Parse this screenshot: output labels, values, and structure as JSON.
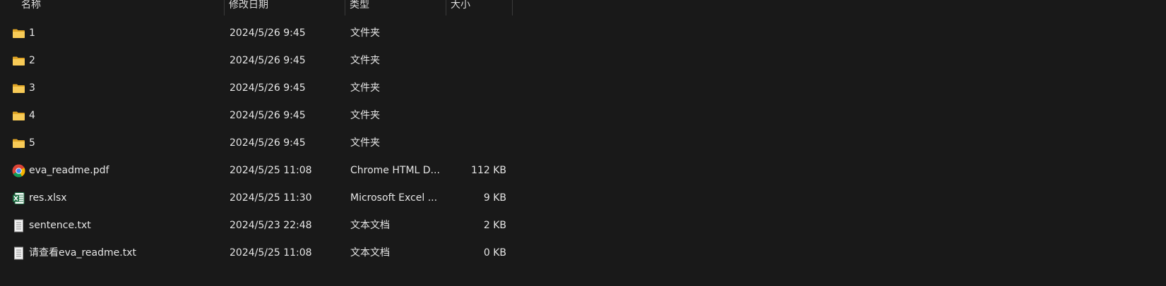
{
  "columns": {
    "name": "名称",
    "date": "修改日期",
    "type": "类型",
    "size": "大小"
  },
  "files": [
    {
      "name": "1",
      "date": "2024/5/26 9:45",
      "type": "文件夹",
      "size": "",
      "icon": "folder-icon"
    },
    {
      "name": "2",
      "date": "2024/5/26 9:45",
      "type": "文件夹",
      "size": "",
      "icon": "folder-icon"
    },
    {
      "name": "3",
      "date": "2024/5/26 9:45",
      "type": "文件夹",
      "size": "",
      "icon": "folder-icon"
    },
    {
      "name": "4",
      "date": "2024/5/26 9:45",
      "type": "文件夹",
      "size": "",
      "icon": "folder-icon"
    },
    {
      "name": "5",
      "date": "2024/5/26 9:45",
      "type": "文件夹",
      "size": "",
      "icon": "folder-icon"
    },
    {
      "name": "eva_readme.pdf",
      "date": "2024/5/25 11:08",
      "type": "Chrome HTML D...",
      "size": "112 KB",
      "icon": "chrome-icon"
    },
    {
      "name": "res.xlsx",
      "date": "2024/5/25 11:30",
      "type": "Microsoft Excel ...",
      "size": "9 KB",
      "icon": "excel-icon"
    },
    {
      "name": "sentence.txt",
      "date": "2024/5/23 22:48",
      "type": "文本文档",
      "size": "2 KB",
      "icon": "text-file-icon"
    },
    {
      "name": "请查看eva_readme.txt",
      "date": "2024/5/25 11:08",
      "type": "文本文档",
      "size": "0 KB",
      "icon": "text-file-icon"
    }
  ],
  "colors": {
    "background": "#191919",
    "text": "#e6e6e6",
    "folder": "#f2c24a",
    "excel": "#1e7145"
  }
}
